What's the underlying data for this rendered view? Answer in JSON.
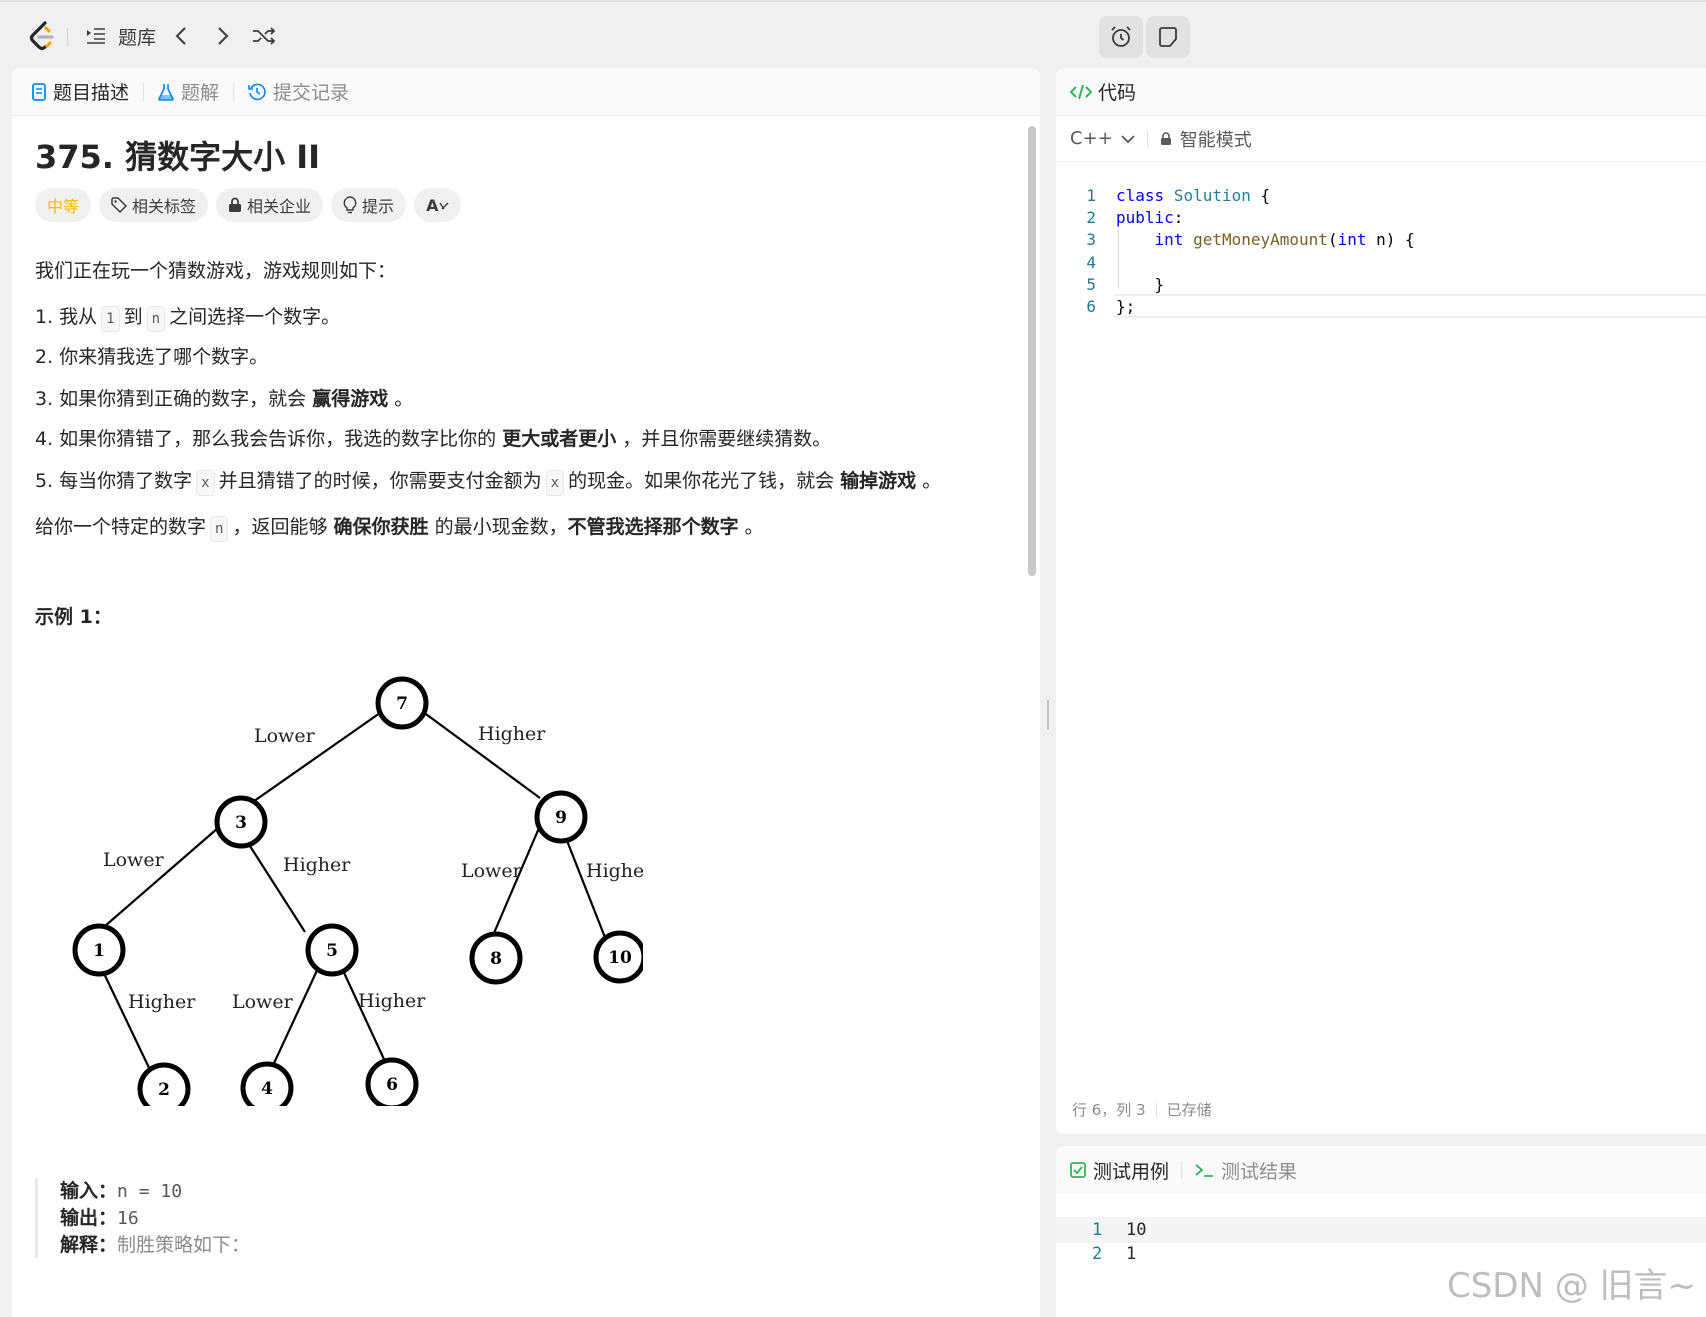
{
  "topbar": {
    "problem_bank_label": "题库"
  },
  "left": {
    "tabs": [
      {
        "label": "题目描述"
      },
      {
        "label": "题解"
      },
      {
        "label": "提交记录"
      }
    ],
    "title": "375. 猜数字大小 II",
    "chips": {
      "difficulty": "中等",
      "tags": "相关标签",
      "companies": "相关企业",
      "hint": "提示",
      "translate": "A"
    },
    "intro": "我们正在玩一个猜数游戏，游戏规则如下：",
    "rules": {
      "r1_a": "1. 我从",
      "r1_code1": "1",
      "r1_b": "到",
      "r1_code2": "n",
      "r1_c": "之间选择一个数字。",
      "r2": "2. 你来猜我选了哪个数字。",
      "r3_a": "3. 如果你猜到正确的数字，就会",
      "r3_bold": "赢得游戏",
      "r3_c": "。",
      "r4_a": "4. 如果你猜错了，那么我会告诉你，我选的数字比你的",
      "r4_bold": "更大或者更小",
      "r4_c": "，并且你需要继续猜数。",
      "r5_a": "5. 每当你猜了数字",
      "r5_code": "x",
      "r5_b": "并且猜错了的时候，你需要支付金额为",
      "r5_code2": "x",
      "r5_c": "的现金。如果你花光了钱，就会",
      "r5_bold": "输掉游戏",
      "r5_d": "。"
    },
    "summary": {
      "a": "给你一个特定的数字",
      "code": "n",
      "b": "，返回能够",
      "bold1": "确保你获胜",
      "c": "的最小现金数，",
      "bold2": "不管我选择那个数字",
      "d": "。"
    },
    "example_title": "示例 1：",
    "tree": {
      "nodes": [
        "7",
        "3",
        "9",
        "1",
        "5",
        "8",
        "10",
        "2",
        "4",
        "6"
      ],
      "edge_lower": "Lower",
      "edge_higher": "Higher"
    },
    "example": {
      "input_key": "输入：",
      "input_val": "n = 10",
      "output_key": "输出：",
      "output_val": "16",
      "explain_key": "解释：",
      "explain_val": "制胜策略如下："
    }
  },
  "right": {
    "tab_label": "代码",
    "language": "C++",
    "mode": "智能模式",
    "code_lines": [
      "1",
      "2",
      "3",
      "4",
      "5",
      "6"
    ],
    "status_pos": "行 6，列 3",
    "status_saved": "已存储"
  },
  "test": {
    "tab_cases": "测试用例",
    "tab_results": "测试结果",
    "lines": [
      {
        "n": "1",
        "text": "10"
      },
      {
        "n": "2",
        "text": "1"
      }
    ]
  },
  "watermark": "CSDN @ 旧言~",
  "colors": {
    "difficulty_medium": "#ffb800",
    "accent_blue": "#0a84ff",
    "accent_green": "#2db55d"
  }
}
